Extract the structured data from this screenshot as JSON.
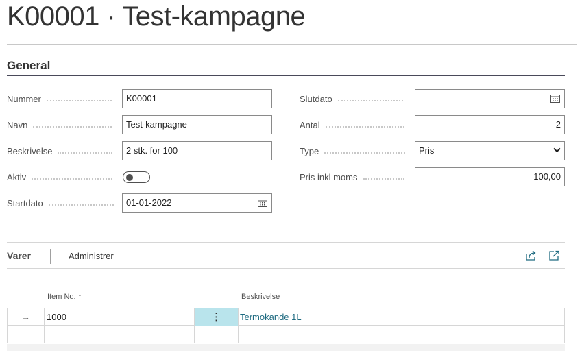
{
  "page": {
    "title": "K00001 · Test-kampagne"
  },
  "section": {
    "title": "General"
  },
  "fields_left": {
    "nummer": {
      "label": "Nummer",
      "value": "K00001"
    },
    "navn": {
      "label": "Navn",
      "value": "Test-kampagne"
    },
    "beskrivelse": {
      "label": "Beskrivelse",
      "value": "2 stk. for 100"
    },
    "aktiv": {
      "label": "Aktiv",
      "value": false
    },
    "startdato": {
      "label": "Startdato",
      "value": "01-01-2022"
    }
  },
  "fields_right": {
    "slutdato": {
      "label": "Slutdato",
      "value": ""
    },
    "antal": {
      "label": "Antal",
      "value": "2"
    },
    "type": {
      "label": "Type",
      "value": "Pris"
    },
    "pris": {
      "label": "Pris inkl moms",
      "value": "100,00"
    }
  },
  "subpage": {
    "tab_varer": "Varer",
    "tab_admin": "Administrer",
    "columns": {
      "item_no": "Item No.",
      "sort_arrow": "↑",
      "beskrivelse": "Beskrivelse"
    },
    "rows": [
      {
        "marker": "→",
        "item_no": "1000",
        "actions": "⋮",
        "beskrivelse": "Termokande 1L"
      }
    ]
  },
  "icons": {
    "calendar": "calendar-icon",
    "share": "share-icon",
    "expand": "expand-icon"
  },
  "colors": {
    "accent_link": "#1e6a80",
    "selected_cell": "#b9e4ec"
  }
}
